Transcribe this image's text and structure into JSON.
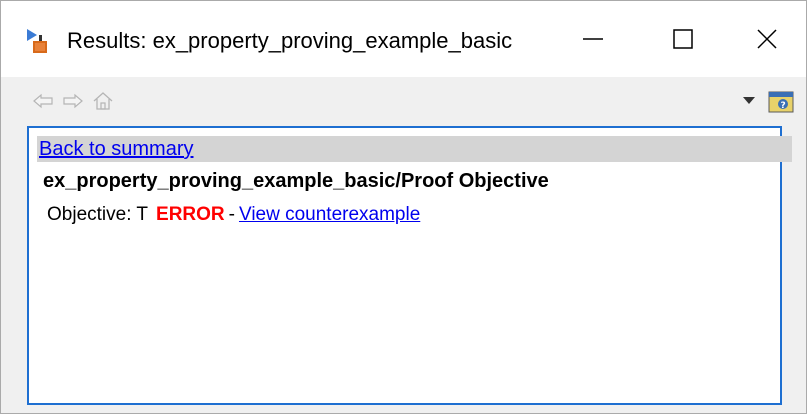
{
  "window": {
    "title": "Results: ex_property_proving_example_basic",
    "minimize_glyph": "—",
    "maximize_glyph": "☐",
    "close_glyph": "✕"
  },
  "toolbar": {
    "icons": [
      "back-arrow-icon",
      "forward-arrow-icon",
      "home-icon",
      "dropdown-arrow-icon",
      "help-icon"
    ]
  },
  "content": {
    "back_link": "Back to summary",
    "objective_title": "ex_property_proving_example_basic/Proof Objective",
    "objective_label": "Objective: T",
    "status": "ERROR",
    "separator": "-",
    "counterexample_link": "View counterexample"
  },
  "colors": {
    "error": "#ff0000",
    "link": "#0000ee",
    "focus_border": "#1e6fd1",
    "summary_bar": "#d4d4d4"
  }
}
